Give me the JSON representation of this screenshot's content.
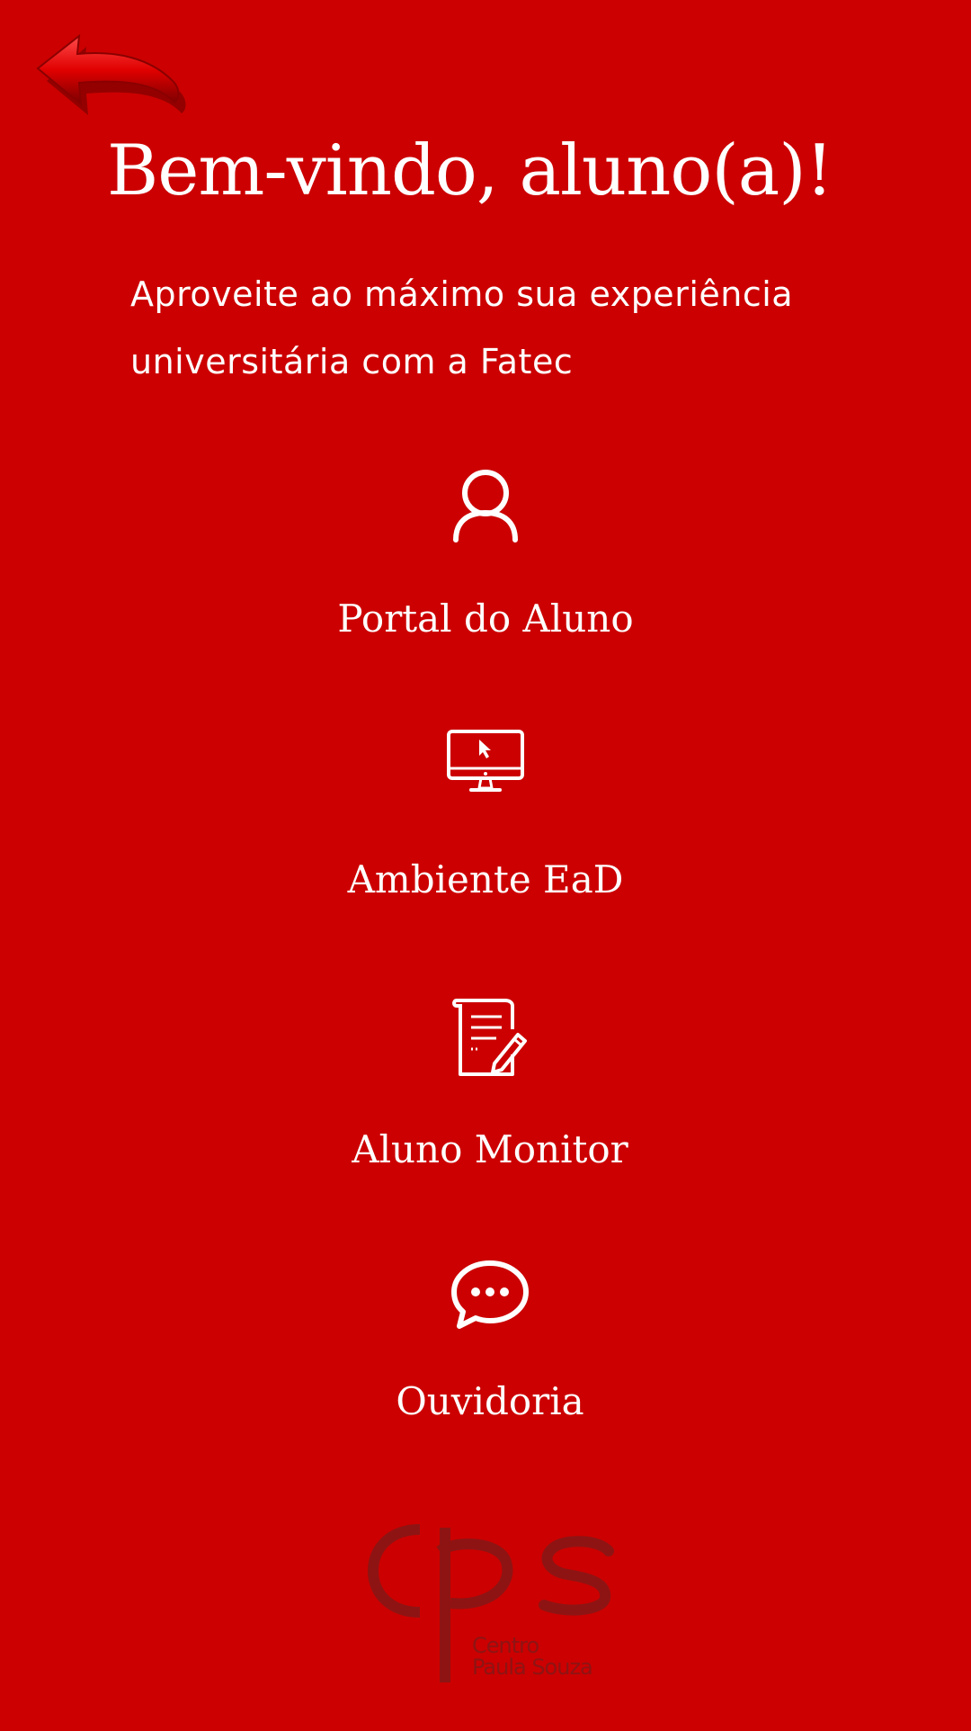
{
  "header": {
    "back_icon": "back-arrow-icon",
    "title": "Bem-vindo, aluno(a)!",
    "subtitle_line1": "Aproveite ao máximo sua experiência",
    "subtitle_line2": "universitária com a Fatec"
  },
  "menu": {
    "items": [
      {
        "label": "Portal do Aluno",
        "icon": "user-icon"
      },
      {
        "label": "Ambiente EaD",
        "icon": "monitor-cursor-icon"
      },
      {
        "label": "Aluno Monitor",
        "icon": "document-edit-icon"
      },
      {
        "label": "Ouvidoria",
        "icon": "chat-bubble-icon"
      }
    ]
  },
  "footer": {
    "logo_icon": "cps-logo-icon",
    "logo_line1": "Centro",
    "logo_line2": "Paula Souza"
  },
  "colors": {
    "background": "#cc0000",
    "text": "#ffffff",
    "logo": "#8e1414"
  }
}
